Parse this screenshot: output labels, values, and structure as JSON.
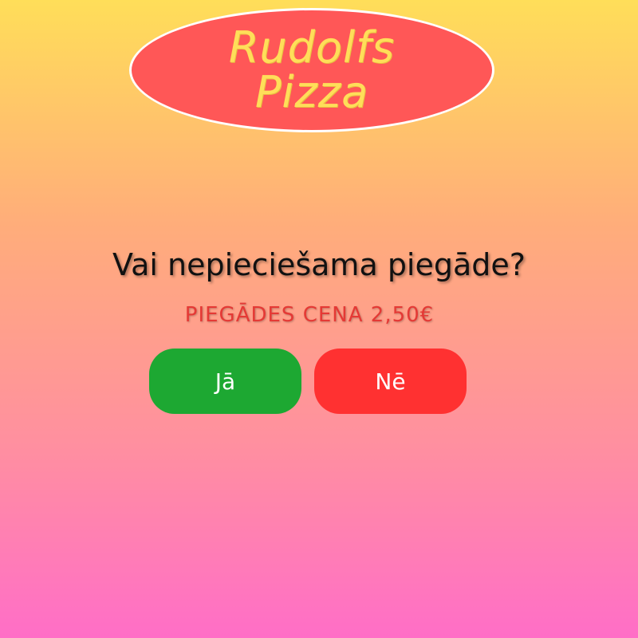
{
  "logo": {
    "line1": "Rudolfs",
    "line2": "Pizza"
  },
  "prompt": {
    "question": "Vai nepieciešama piegāde?",
    "price_note": "PIEGĀDES CENA 2,50€"
  },
  "buttons": {
    "yes_label": "Jā",
    "no_label": "Nē"
  },
  "colors": {
    "logo_bg": "#ff5757",
    "logo_text": "#ffde59",
    "price_text": "#e53935",
    "yes_button": "#1da832",
    "no_button": "#ff3131"
  }
}
